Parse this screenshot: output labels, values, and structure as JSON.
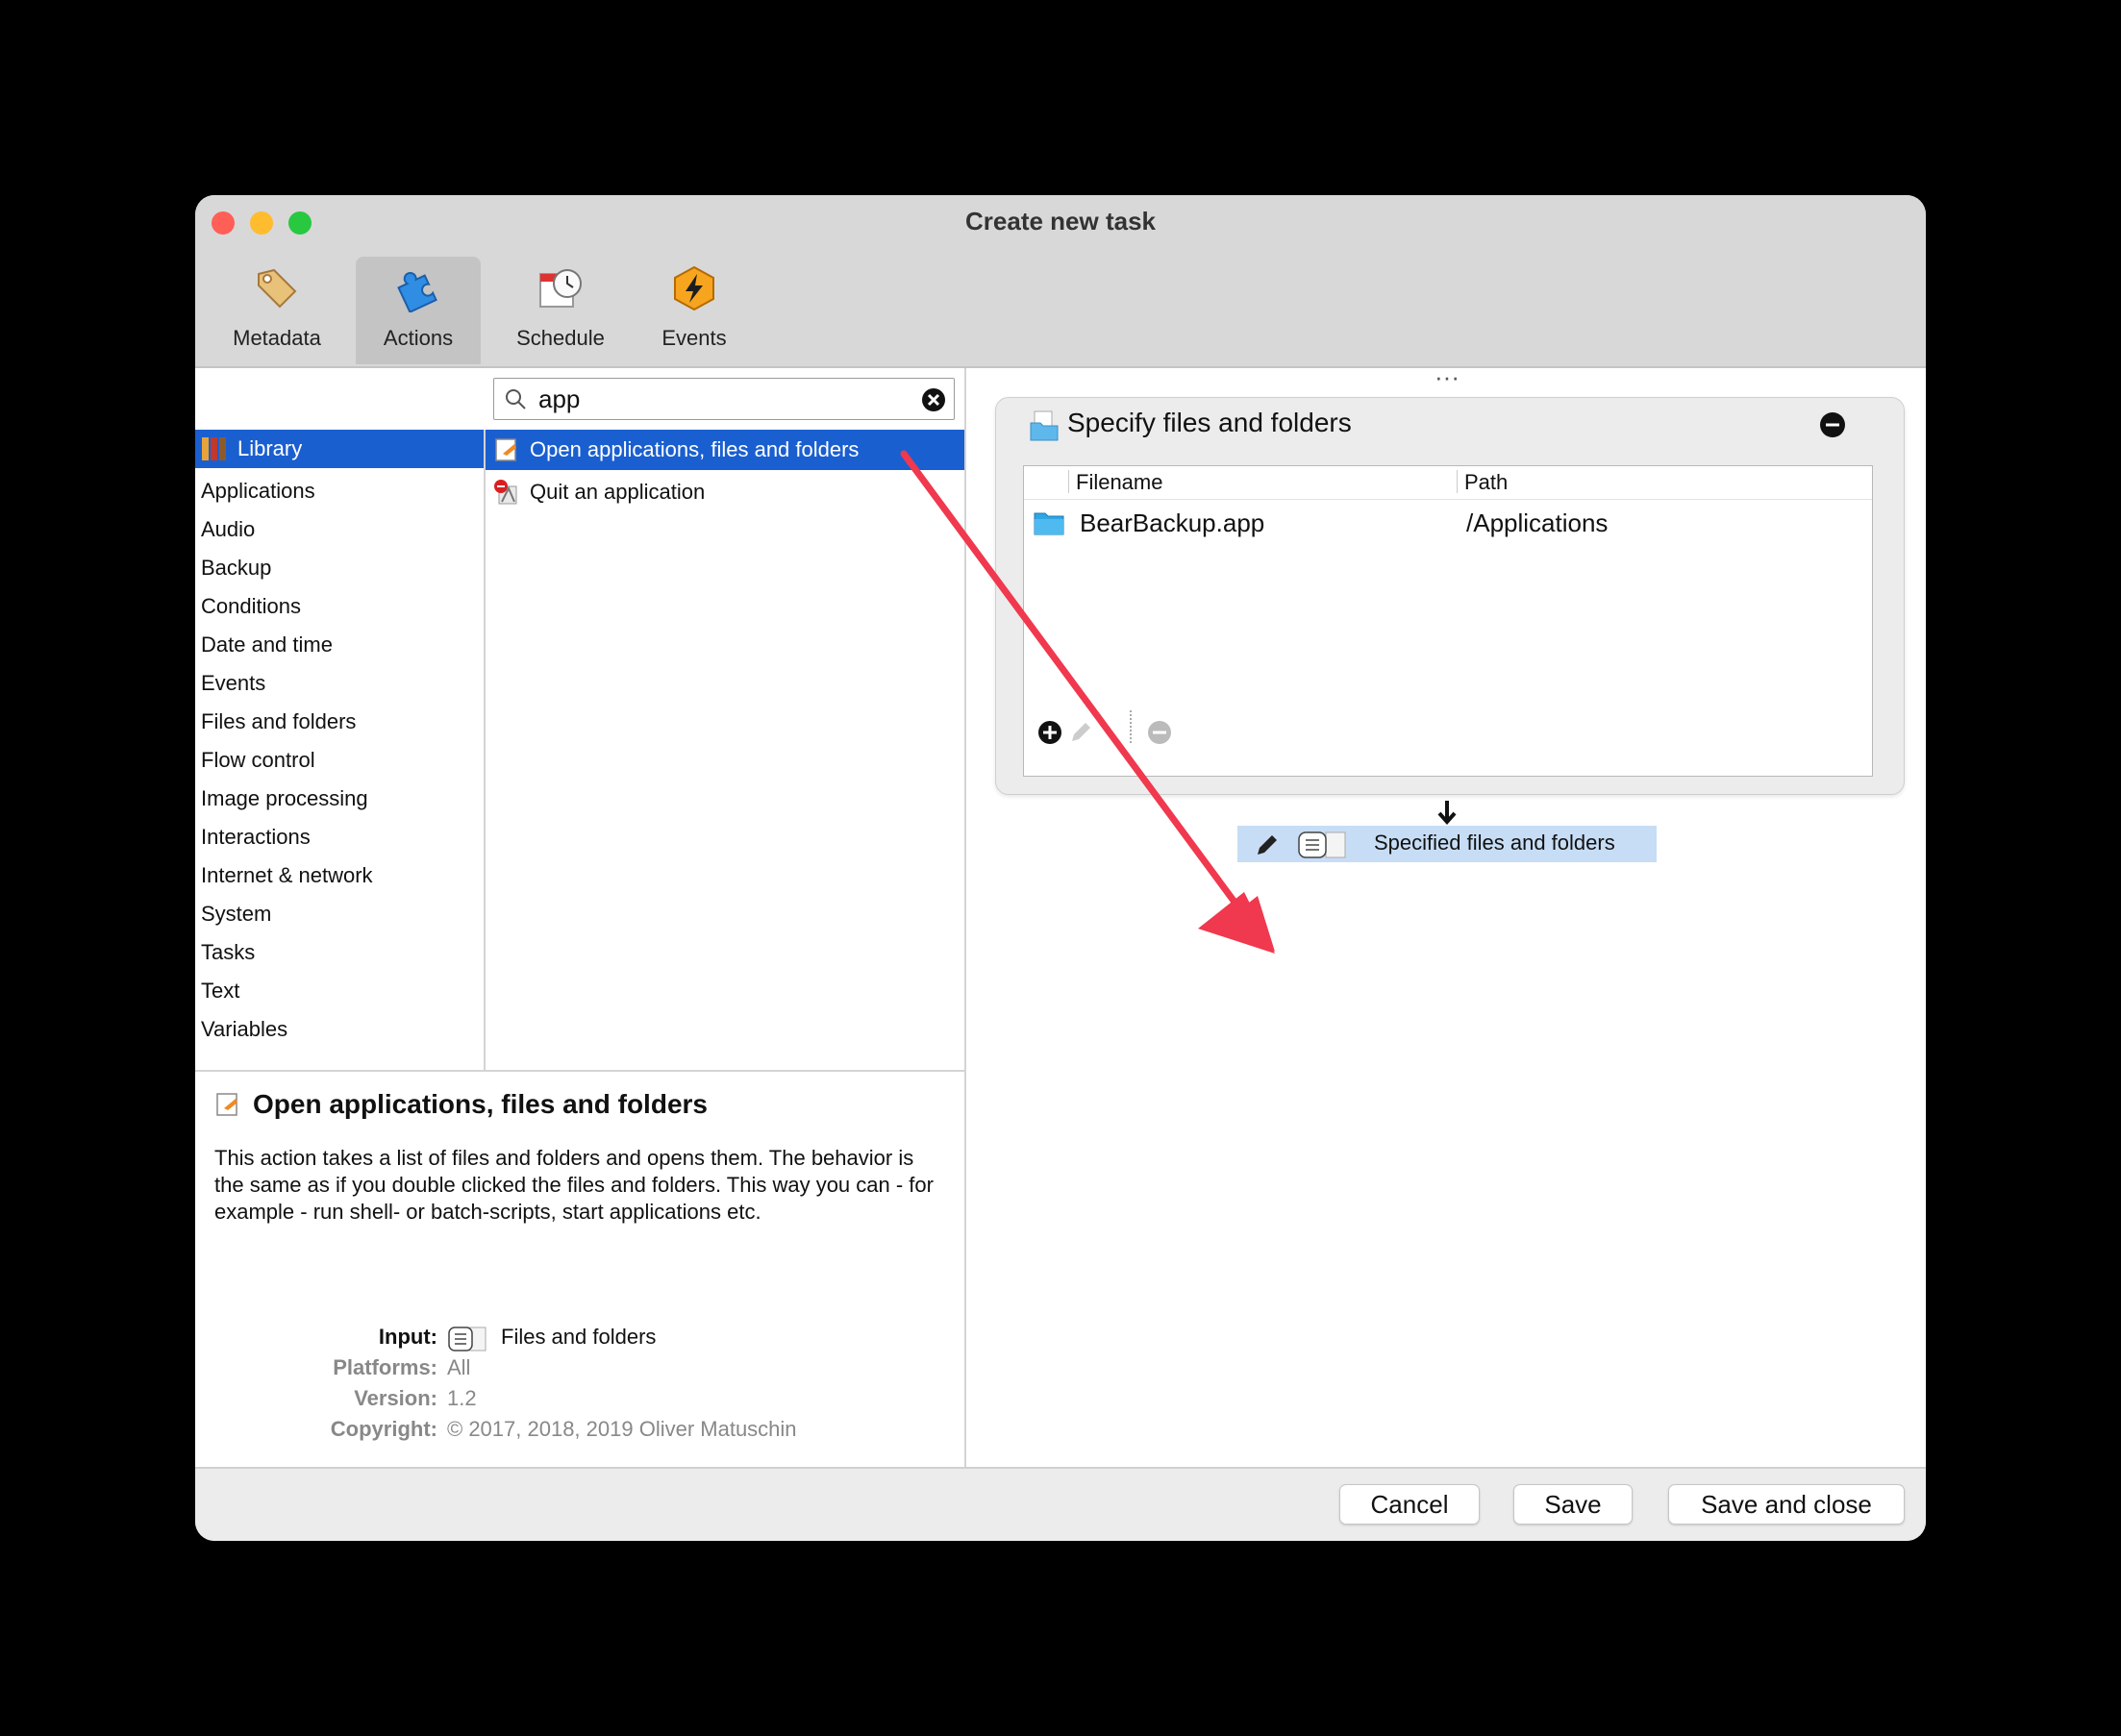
{
  "window": {
    "title": "Create new task"
  },
  "toolbar": {
    "tabs": [
      {
        "label": "Metadata",
        "icon": "tag-icon"
      },
      {
        "label": "Actions",
        "icon": "puzzle-icon"
      },
      {
        "label": "Schedule",
        "icon": "calendar-clock-icon"
      },
      {
        "label": "Events",
        "icon": "lightning-icon"
      }
    ],
    "active": "Actions"
  },
  "search": {
    "value": "app"
  },
  "categories": [
    "Library",
    "Applications",
    "Audio",
    "Backup",
    "Conditions",
    "Date and time",
    "Events",
    "Files and folders",
    "Flow control",
    "Image processing",
    "Interactions",
    "Internet & network",
    "System",
    "Tasks",
    "Text",
    "Variables"
  ],
  "actions": [
    {
      "label": "Open applications, files and folders",
      "selected": true
    },
    {
      "label": "Quit an application",
      "selected": false
    }
  ],
  "description": {
    "title": "Open applications, files and folders",
    "body": "This action takes a list of files and folders and opens them. The behavior is the same as if you double clicked the files and folders. This way you can - for example - run shell- or batch-scripts, start applications etc.",
    "input_label": "Input:",
    "input_value": "Files and folders",
    "platforms_label": "Platforms:",
    "platforms_value": "All",
    "version_label": "Version:",
    "version_value": "1.2",
    "copyright_label": "Copyright:",
    "copyright_value": "© 2017, 2018, 2019 Oliver Matuschin"
  },
  "workflow": {
    "more_dots": "···",
    "card_title": "Specify files and folders",
    "columns": {
      "filename": "Filename",
      "path": "Path"
    },
    "rows": [
      {
        "filename": "BearBackup.app",
        "path": "/Applications"
      }
    ],
    "output_label": "Specified files and folders"
  },
  "footer": {
    "cancel": "Cancel",
    "save": "Save",
    "save_close": "Save and close"
  },
  "colors": {
    "selection": "#1a5fd0",
    "annotation_arrow": "#f0384e",
    "close": "#ff5f57",
    "minimize": "#febc2e",
    "zoom": "#28c840"
  }
}
